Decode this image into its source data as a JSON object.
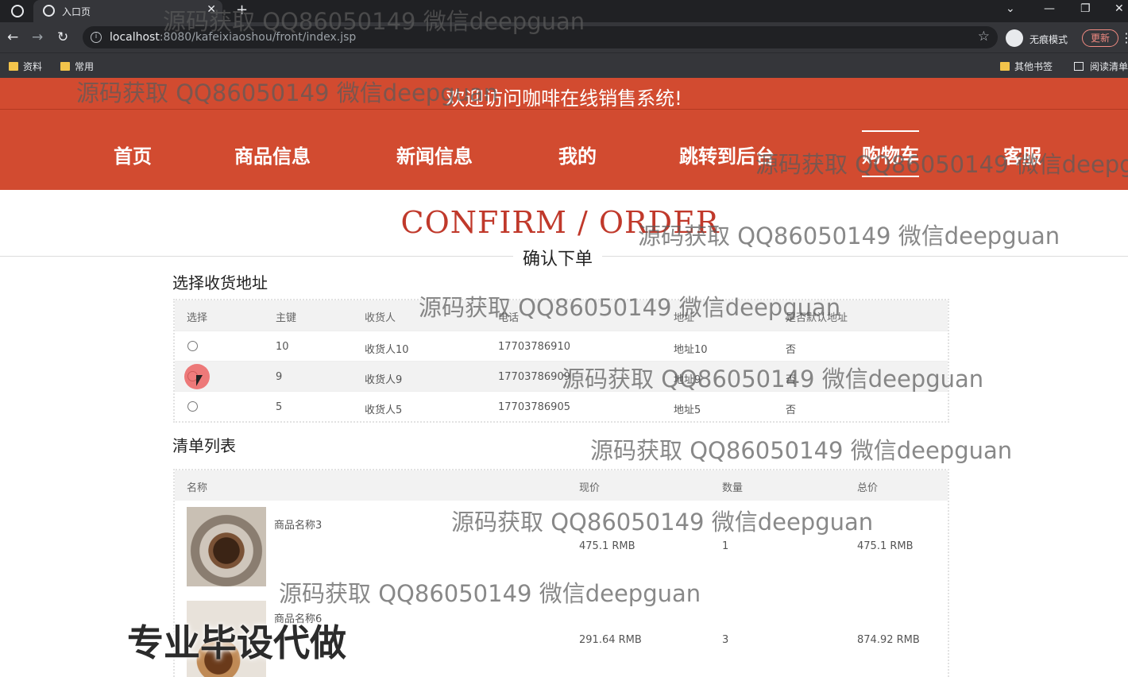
{
  "browser": {
    "tab_title": "入口页",
    "new_tab": "+",
    "url_host": "localhost",
    "url_rest": ":8080/kafeixiaoshou/front/index.jsp",
    "incognito_label": "无痕模式",
    "update_label": "更新",
    "bookmarks": [
      "资料",
      "常用"
    ],
    "bookmarks_right": [
      "其他书签",
      "阅读清单"
    ]
  },
  "site": {
    "welcome": "欢迎访问咖啡在线销售系统!",
    "nav": [
      "首页",
      "商品信息",
      "新闻信息",
      "我的",
      "跳转到后台",
      "购物车",
      "客服"
    ],
    "active_nav": "购物车"
  },
  "page": {
    "title_en": "CONFIRM / ORDER",
    "title_cn": "确认下单",
    "address_section": "选择收货地址",
    "items_section": "清单列表"
  },
  "address_table": {
    "headers": [
      "选择",
      "主键",
      "收货人",
      "电话",
      "地址",
      "是否默认地址"
    ],
    "rows": [
      {
        "id": "10",
        "name": "收货人10",
        "phone": "17703786910",
        "address": "地址10",
        "default": "否"
      },
      {
        "id": "9",
        "name": "收货人9",
        "phone": "17703786909",
        "address": "地址9",
        "default": "否"
      },
      {
        "id": "5",
        "name": "收货人5",
        "phone": "17703786905",
        "address": "地址5",
        "default": "否"
      }
    ]
  },
  "items_table": {
    "headers": [
      "名称",
      "现价",
      "数量",
      "总价"
    ],
    "rows": [
      {
        "name": "商品名称3",
        "price": "475.1 RMB",
        "qty": "1",
        "total": "475.1 RMB"
      },
      {
        "name": "商品名称6",
        "price": "291.64 RMB",
        "qty": "3",
        "total": "874.92 RMB"
      }
    ]
  },
  "watermark": "源码获取 QQ86050149 微信deepguan",
  "overlay_badge": "专业毕设代做",
  "colors": {
    "brand_red": "#d24b30",
    "title_red": "#c0392b"
  }
}
